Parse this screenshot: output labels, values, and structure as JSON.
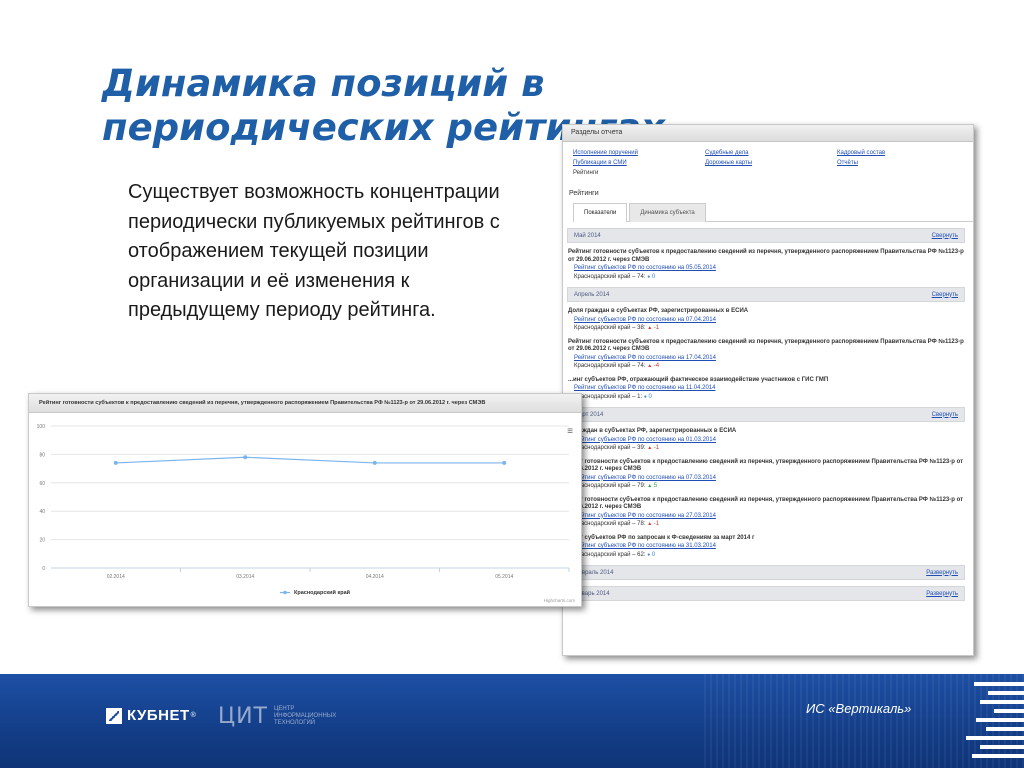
{
  "slide": {
    "title": "Динамика позиций в периодических рейтингах",
    "body": "Существует возможность концентрации периодически публикуемых рейтингов с отображением текущей позиции организации и её изменения к предыдущему периоду рейтинга."
  },
  "report": {
    "header": "Разделы отчета",
    "sections": [
      [
        "Исполнение поручений",
        "Публикации в СМИ",
        "Рейтинги"
      ],
      [
        "Судебные дела",
        "Дорожные карты"
      ],
      [
        "Кадровый состав",
        "Отчёты"
      ]
    ],
    "ratings_label": "Рейтинги",
    "tabs": [
      "Показатели",
      "Динамика субъекта"
    ],
    "periods": [
      {
        "month": "Май 2014",
        "action": "Свернуть",
        "items": [
          {
            "title": "Рейтинг готовности субъектов к предоставлению сведений из перечня, утвержденного распоряжением Правительства РФ №1123-р от 29.06.2012 г. через СМЭВ",
            "link": "Рейтинг субъектов РФ по состоянию на 05.05.2014",
            "region": "Краснодарский край – 74:",
            "change": "0",
            "dir": "zero"
          }
        ]
      },
      {
        "month": "Апрель 2014",
        "action": "Свернуть",
        "items": [
          {
            "title": "Доля граждан в субъектах РФ, зарегистрированных в ЕСИА",
            "link": "Рейтинг субъектов РФ по состоянию на 07.04.2014",
            "region": "Краснодарский край – 38:",
            "change": "-1",
            "dir": "down"
          },
          {
            "title": "Рейтинг готовности субъектов к предоставлению сведений из перечня, утвержденного распоряжением Правительства РФ №1123-р от 29.06.2012 г. через СМЭВ",
            "link": "Рейтинг субъектов РФ по состоянию на 17.04.2014",
            "region": "Краснодарский край – 74:",
            "change": "-4",
            "dir": "down"
          },
          {
            "title": "...инг субъектов РФ, отражающий фактическое взаимодействие участников с ГИС ГМП",
            "link": "Рейтинг субъектов РФ по состоянию на 11.04.2014",
            "region": "Краснодарский край – 1:",
            "change": "0",
            "dir": "zero"
          }
        ]
      },
      {
        "month": "Март 2014",
        "action": "Свернуть",
        "items": [
          {
            "title": "...граждан в субъектах РФ, зарегистрированных в ЕСИА",
            "link": "Рейтинг субъектов РФ по состоянию на 01.03.2014",
            "region": "Краснодарский край – 39:",
            "change": "-1",
            "dir": "down"
          },
          {
            "title": "...инг готовности субъектов к предоставлению сведений из перечня, утвержденного распоряжением Правительства РФ №1123-р от 29.06.2012 г. через СМЭВ",
            "link": "Рейтинг субъектов РФ по состоянию на 07.03.2014",
            "region": "Краснодарский край – 79:",
            "change": "5",
            "dir": "up"
          },
          {
            "title": "...инг готовности субъектов к предоставлению сведений из перечня, утвержденного распоряжением Правительства РФ №1123-р от 29.06.2012 г. через СМЭВ",
            "link": "Рейтинг субъектов РФ по состоянию на 27.03.2014",
            "region": "Краснодарский край – 78:",
            "change": "-1",
            "dir": "down"
          },
          {
            "title": "...инг субъектов РФ по запросам к Ф-сведениям за март 2014 г",
            "link": "Рейтинг субъектов РФ по состоянию на 31.03.2014",
            "region": "Краснодарский край – 62:",
            "change": "0",
            "dir": "zero"
          }
        ]
      },
      {
        "month": "Февраль 2014",
        "action": "Развернуть",
        "items": []
      },
      {
        "month": "Январь 2014",
        "action": "Развернуть",
        "items": []
      }
    ]
  },
  "chart_panel": {
    "header": "Рейтинг готовности субъектов к предоставлению сведений из перечня, утвержденного распоряжением Правительства РФ №1123-р от 29.06.2012 г. через СМЭВ",
    "menu_icon": "hamburger-icon",
    "credit": "Highcharts.com"
  },
  "chart_data": {
    "type": "line",
    "categories": [
      "02.2014",
      "03.2014",
      "04.2014",
      "05.2014"
    ],
    "series": [
      {
        "name": "Краснодарский край",
        "values": [
          74,
          78,
          74,
          74
        ],
        "color": "#7cb5ec"
      }
    ],
    "ylim": [
      0,
      100
    ],
    "yticks": [
      0,
      20,
      40,
      60,
      80,
      100
    ],
    "grid": true,
    "legend": "bottom-center"
  },
  "footer": {
    "kubnet": "КУБНЕТ",
    "kubnet_reg": "®",
    "cit_mark": "ЦИТ",
    "cit_text": "ЦЕНТР ИНФОРМАЦИОННЫХ ТЕХНОЛОГИЙ",
    "system": "ИС «Вертикаль»"
  },
  "colors": {
    "title": "#1f5fa8",
    "footer": "#1d4fa4",
    "link": "#1f4fb5",
    "down": "#d23a2a",
    "up": "#2e9e3a",
    "series": "#7cb5ec"
  }
}
